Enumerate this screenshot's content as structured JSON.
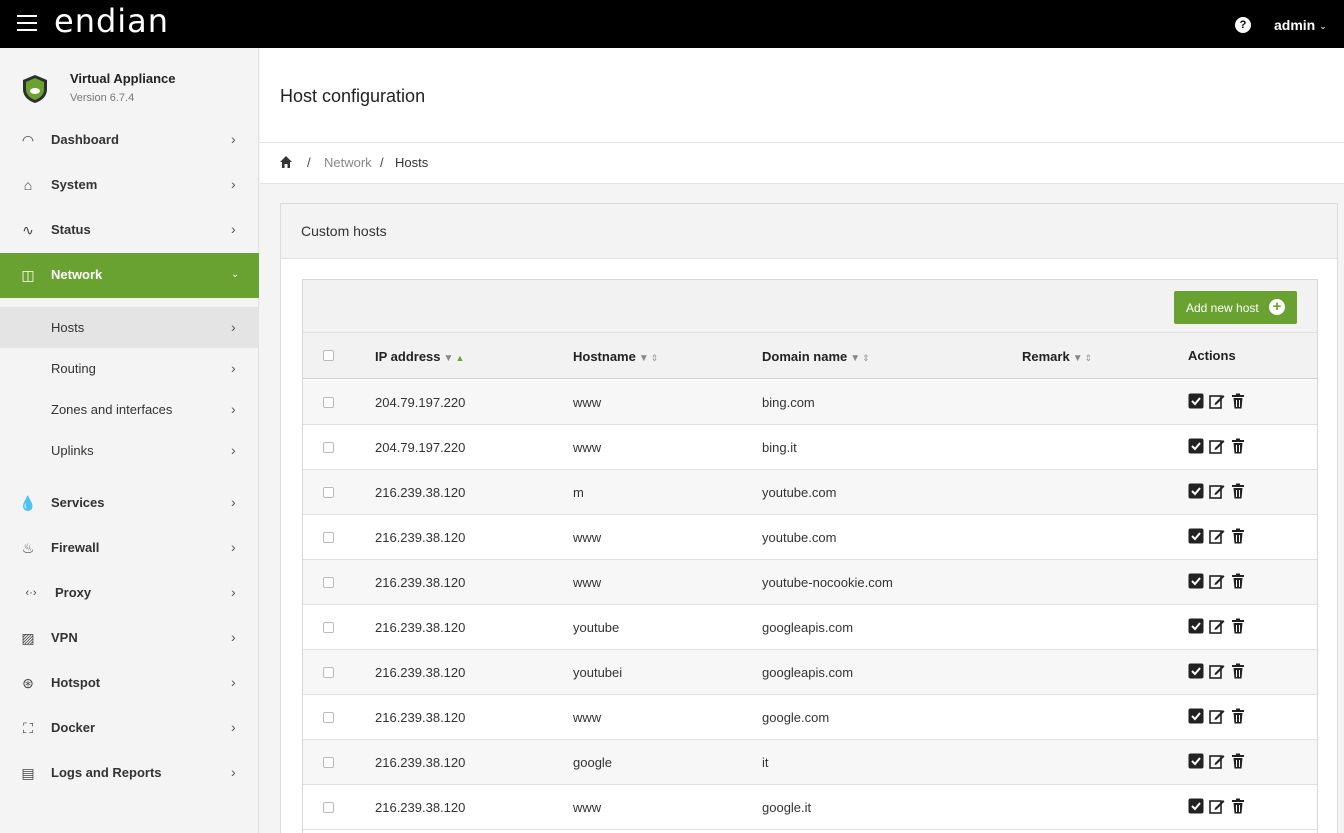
{
  "topbar": {
    "logo": "endian",
    "user": "admin"
  },
  "sidebar": {
    "brand_name": "Virtual Appliance",
    "brand_version": "Version 6.7.4",
    "items": [
      {
        "label": "Dashboard",
        "icon": "gauge-icon"
      },
      {
        "label": "System",
        "icon": "home-icon"
      },
      {
        "label": "Status",
        "icon": "pulse-icon"
      },
      {
        "label": "Network",
        "icon": "network-icon"
      },
      {
        "label": "Services",
        "icon": "drop-icon"
      },
      {
        "label": "Firewall",
        "icon": "flame-icon"
      },
      {
        "label": "Proxy",
        "icon": "proxy-icon"
      },
      {
        "label": "VPN",
        "icon": "lock-icon"
      },
      {
        "label": "Hotspot",
        "icon": "antenna-icon"
      },
      {
        "label": "Docker",
        "icon": "docker-icon"
      },
      {
        "label": "Logs and Reports",
        "icon": "bar-chart-icon"
      }
    ],
    "network_sub": [
      "Hosts",
      "Routing",
      "Zones and interfaces",
      "Uplinks"
    ]
  },
  "header": {
    "title": "Host configuration"
  },
  "breadcrumb": {
    "items": [
      "Network",
      "Hosts"
    ]
  },
  "panel": {
    "title": "Custom hosts",
    "add_button": "Add new host",
    "columns": [
      "IP address",
      "Hostname",
      "Domain name",
      "Remark",
      "Actions"
    ],
    "rows": [
      {
        "ip": "204.79.197.220",
        "host": "www",
        "domain": "bing.com",
        "remark": ""
      },
      {
        "ip": "204.79.197.220",
        "host": "www",
        "domain": "bing.it",
        "remark": ""
      },
      {
        "ip": "216.239.38.120",
        "host": "m",
        "domain": "youtube.com",
        "remark": ""
      },
      {
        "ip": "216.239.38.120",
        "host": "www",
        "domain": "youtube.com",
        "remark": ""
      },
      {
        "ip": "216.239.38.120",
        "host": "www",
        "domain": "youtube-nocookie.com",
        "remark": ""
      },
      {
        "ip": "216.239.38.120",
        "host": "youtube",
        "domain": "googleapis.com",
        "remark": ""
      },
      {
        "ip": "216.239.38.120",
        "host": "youtubei",
        "domain": "googleapis.com",
        "remark": ""
      },
      {
        "ip": "216.239.38.120",
        "host": "www",
        "domain": "google.com",
        "remark": ""
      },
      {
        "ip": "216.239.38.120",
        "host": "google",
        "domain": "it",
        "remark": ""
      },
      {
        "ip": "216.239.38.120",
        "host": "www",
        "domain": "google.it",
        "remark": ""
      }
    ]
  },
  "colors": {
    "accent": "#6aa231",
    "topbar": "#000000"
  }
}
